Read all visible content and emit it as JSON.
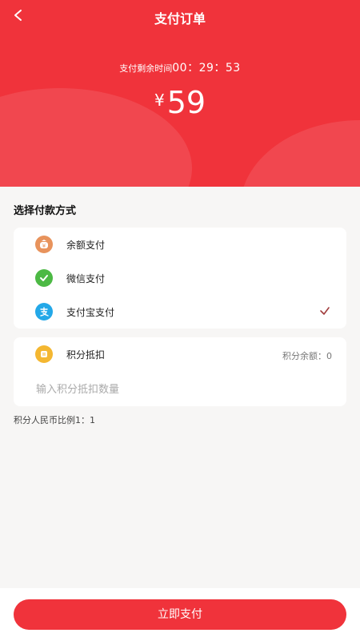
{
  "header": {
    "title": "支付订单",
    "countdown_label": "支付剩余时间",
    "countdown_time": "00：29：53",
    "currency": "¥",
    "amount": "59"
  },
  "payment": {
    "section_title": "选择付款方式",
    "methods": [
      {
        "label": "余额支付",
        "icon": "wallet-icon",
        "color": "#e8935c",
        "selected": false
      },
      {
        "label": "微信支付",
        "icon": "wechat-icon",
        "color": "#4cb944",
        "selected": false
      },
      {
        "label": "支付宝支付",
        "icon": "alipay-icon",
        "color": "#23a8e8",
        "selected": true
      }
    ]
  },
  "points": {
    "label": "积分抵扣",
    "balance": "积分余额：0",
    "input_placeholder": "输入积分抵扣数量",
    "ratio": "积分人民币比例1：1"
  },
  "footer": {
    "pay_label": "立即支付"
  },
  "colors": {
    "accent": "#f0333b",
    "check": "#a13c3c"
  }
}
